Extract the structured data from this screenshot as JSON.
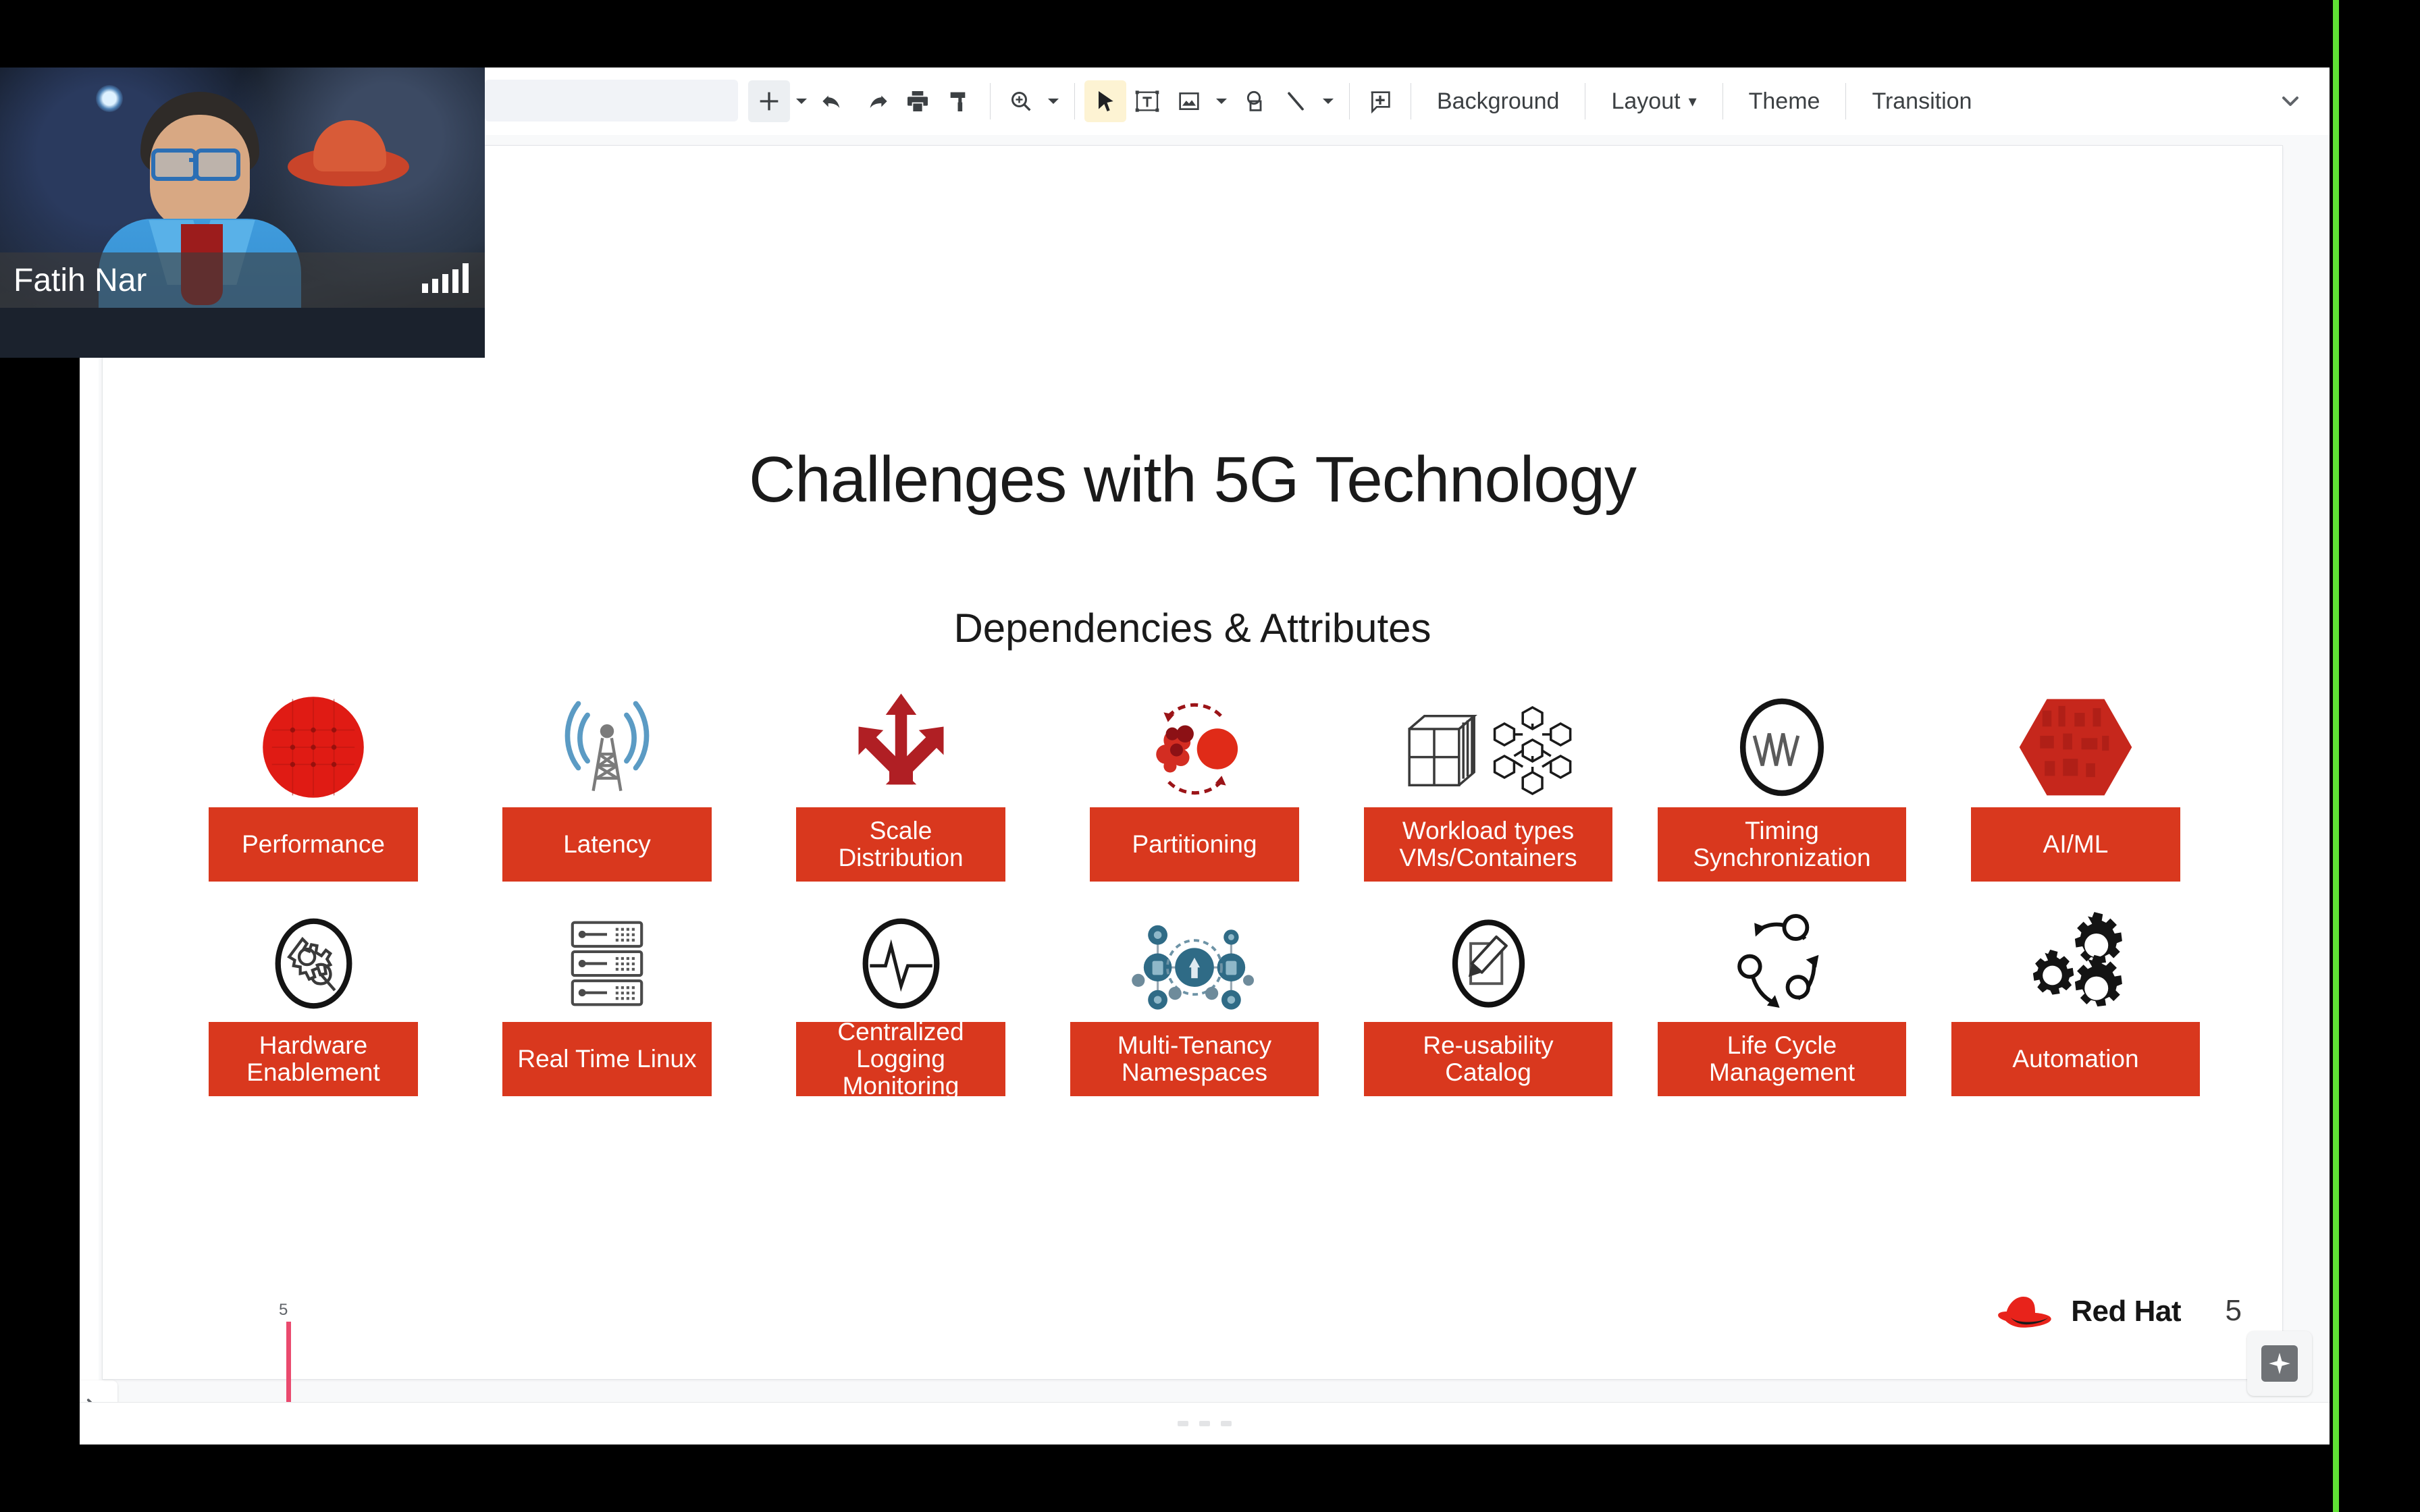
{
  "webcam": {
    "participant_name": "Fatih Nar",
    "signal_icon": "signal-bars-icon"
  },
  "toolbar": {
    "icons": [
      {
        "name": "add-slide-icon",
        "label": "+"
      },
      {
        "name": "add-slide-dropdown-caret",
        "label": "▾"
      },
      {
        "name": "undo-icon",
        "label": "undo"
      },
      {
        "name": "redo-icon",
        "label": "redo"
      },
      {
        "name": "print-icon",
        "label": "print"
      },
      {
        "name": "paint-format-icon",
        "label": "paint format"
      },
      {
        "name": "zoom-icon",
        "label": "zoom"
      },
      {
        "name": "zoom-dropdown-caret",
        "label": "▾"
      },
      {
        "name": "select-cursor-icon",
        "label": "select"
      },
      {
        "name": "text-box-icon",
        "label": "text box"
      },
      {
        "name": "insert-image-icon",
        "label": "image"
      },
      {
        "name": "image-dropdown-caret",
        "label": "▾"
      },
      {
        "name": "shape-icon",
        "label": "shape"
      },
      {
        "name": "line-icon",
        "label": "line"
      },
      {
        "name": "line-dropdown-caret",
        "label": "▾"
      },
      {
        "name": "comment-icon",
        "label": "comment"
      }
    ],
    "menu_items": [
      {
        "name": "background-button",
        "label": "Background"
      },
      {
        "name": "layout-button",
        "label": "Layout",
        "caret": "▾"
      },
      {
        "name": "theme-button",
        "label": "Theme"
      },
      {
        "name": "transition-button",
        "label": "Transition"
      }
    ],
    "collapse_caret": "▾"
  },
  "slide": {
    "title": "Challenges with 5G Technology",
    "subtitle": "Dependencies & Attributes",
    "accent_color": "#d9381e",
    "page_number": "5",
    "brand": "Red Hat",
    "slide_marker_number": "5",
    "rows": [
      [
        {
          "icon": "red-mesh-circle-icon",
          "lines": [
            "Performance"
          ]
        },
        {
          "icon": "cell-tower-icon",
          "lines": [
            "Latency"
          ]
        },
        {
          "icon": "branching-arrows-icon",
          "lines": [
            "Scale",
            "Distribution"
          ]
        },
        {
          "icon": "partition-cells-icon",
          "lines": [
            "Partitioning"
          ]
        },
        {
          "icon": "vm-container-icon",
          "lines": [
            "Workload types",
            "VMs/Containers"
          ]
        },
        {
          "icon": "clock-waveform-icon",
          "lines": [
            "Timing",
            "Synchronization"
          ]
        },
        {
          "icon": "red-hexagon-data-icon",
          "lines": [
            "AI/ML"
          ]
        }
      ],
      [
        {
          "icon": "gear-wrench-icon",
          "lines": [
            "Hardware",
            "Enablement"
          ]
        },
        {
          "icon": "server-rack-icon",
          "lines": [
            "Real Time Linux"
          ]
        },
        {
          "icon": "heartbeat-monitor-icon",
          "lines": [
            "Centralized",
            "Logging",
            "Monitoring"
          ]
        },
        {
          "icon": "network-nodes-icon",
          "lines": [
            "Multi-Tenancy",
            "Namespaces"
          ]
        },
        {
          "icon": "document-edit-icon",
          "lines": [
            "Re-usability",
            "Catalog"
          ]
        },
        {
          "icon": "lifecycle-loop-icon",
          "lines": [
            "Life Cycle",
            "Management"
          ]
        },
        {
          "icon": "gears-icon",
          "lines": [
            "Automation"
          ]
        }
      ]
    ]
  },
  "bottom": {
    "assist_icon": "sparkle-assist-icon",
    "expand_rail_icon": "chevron-right-icon"
  }
}
